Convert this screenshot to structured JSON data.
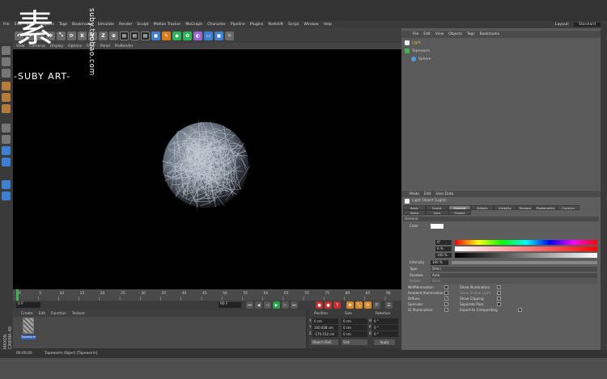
{
  "menubar": {
    "items": [
      "File",
      "Edit",
      "View",
      "Objects",
      "Tags",
      "Bookmarks",
      "Simulate",
      "Render",
      "Sculpt",
      "Motion Tracker",
      "MoGraph",
      "Character",
      "Pipeline",
      "Plugins",
      "Redshift",
      "Script",
      "Window",
      "Help"
    ],
    "layout_label": "Layout:",
    "layout_value": "Standard"
  },
  "object_manager": {
    "menu": [
      "File",
      "Edit",
      "View",
      "Objects",
      "Tags",
      "Bookmarks"
    ],
    "objects": [
      {
        "name": "Light",
        "color": "#e8e8e8"
      },
      {
        "name": "Tapeworm",
        "color": "#3fb34c"
      },
      {
        "name": "Sphere",
        "color": "#4aa0e0"
      }
    ]
  },
  "attribute_manager": {
    "menu": [
      "Mode",
      "Edit",
      "User Data"
    ],
    "title": "Light Object [Light]",
    "tabs_row1": [
      "Basic",
      "Coord.",
      "General",
      "Details",
      "Visibility",
      "Shadow",
      "Photometric",
      "Caustics"
    ],
    "tabs_row2": [
      "Noise",
      "Lens",
      "Project"
    ],
    "active_tab": "General",
    "section": "General",
    "color_label": "Color",
    "h_value": "0°",
    "s_value": "0 %",
    "v_value": "100 %",
    "intensity_label": "Intensity",
    "intensity_value": "100 %",
    "type_label": "Type",
    "type_value": "Omni",
    "shadow_label": "Shadow",
    "shadow_value": "Area",
    "visible_light_label": "Visible Light",
    "visible_light_value": "None",
    "flags_left": [
      "No Illumination",
      "Ambient Illumination",
      "Diffuse",
      "Specular",
      "GI Illumination"
    ],
    "flags_right": [
      "Show Illumination",
      "Show Visible Light",
      "Show Clipping",
      "Separate Pass",
      "Export to Compositing"
    ]
  },
  "timeline": {
    "ticks": [
      "0",
      "5",
      "10",
      "15",
      "20",
      "25",
      "30",
      "35",
      "40",
      "45",
      "50",
      "55",
      "60",
      "65",
      "70",
      "75",
      "80",
      "85",
      "90"
    ],
    "start_field": "0 F",
    "end_field": "90 F"
  },
  "material_manager": {
    "menu": [
      "Create",
      "Edit",
      "Function",
      "Texture"
    ],
    "material_name": "Tapeworm"
  },
  "coordinates": {
    "headers": [
      "Position",
      "Size",
      "Rotation"
    ],
    "rows": [
      {
        "axis": "X",
        "pos": "0 cm",
        "size": "0 cm",
        "rot_axis": "H",
        "rot": "0 °"
      },
      {
        "axis": "Y",
        "pos": "100.028 cm",
        "size": "0 cm",
        "rot_axis": "P",
        "rot": "0 °"
      },
      {
        "axis": "Z",
        "pos": "-170.152 cm",
        "size": "0 cm",
        "rot_axis": "B",
        "rot": "0 °"
      }
    ],
    "mode_select": "Object (Rel)",
    "size_select": "Size",
    "apply_label": "Apply"
  },
  "statusbar": {
    "time": "00:00:00",
    "message": "Tapeworm Object [Tapeworm]"
  },
  "viewport": {
    "menu": [
      "View",
      "Cameras",
      "Display",
      "Options",
      "Filter",
      "Panel",
      "ProRender"
    ]
  },
  "watermark": {
    "glyph": "素",
    "subtitle": "-SUBY ART-",
    "url": "suby.taobao.com"
  },
  "maxon_label": "MAXON CINEMA 4D",
  "colors": {
    "accent_blue": "#3d7fd0",
    "object_green": "#3fb34c"
  }
}
